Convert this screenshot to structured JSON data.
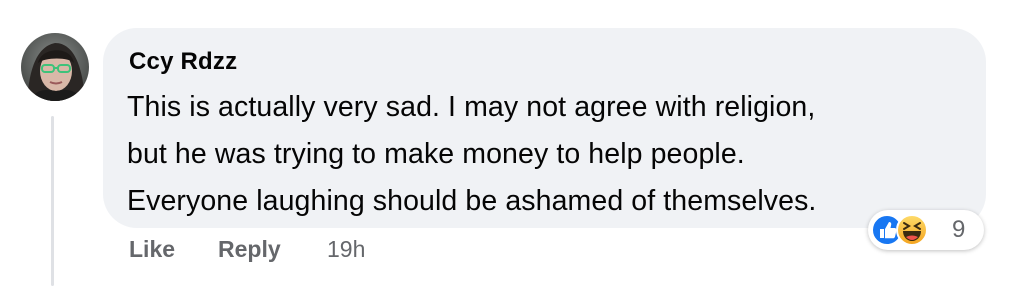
{
  "comment": {
    "author": "Ccy Rdzz",
    "lines": [
      "This is actually very sad. I may not agree with religion,",
      "but he was trying to make money to help people.",
      "Everyone laughing should be ashamed of themselves."
    ],
    "avatar_icon": "avatar",
    "reaction_icons": [
      "like-icon",
      "haha-icon"
    ],
    "reaction_count": "9"
  },
  "actions": {
    "like_label": "Like",
    "reply_label": "Reply",
    "timestamp": "19h"
  },
  "colors": {
    "bubble_bg": "#f0f2f5",
    "text": "#050505",
    "secondary_text": "#65676b",
    "like_blue": "#1877f2",
    "haha_yellow": "#f7b125"
  }
}
